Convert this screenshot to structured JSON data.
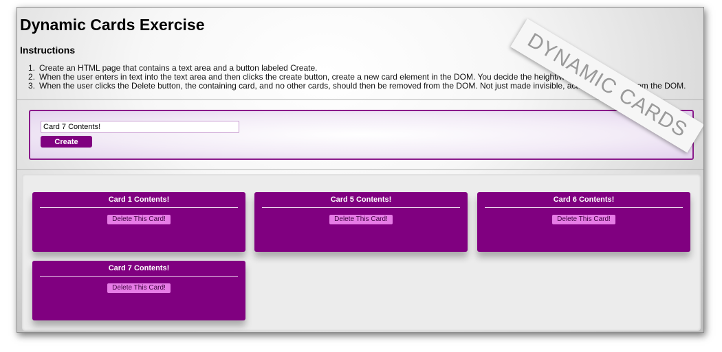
{
  "page": {
    "title": "Dynamic Cards Exercise",
    "instructions_heading": "Instructions",
    "instructions": [
      "Create an HTML page that contains a text area and a button labeled Create.",
      "When the user enters in text into the text area and then clicks the create button, create a new card element in the DOM. You decide the height/width of the card.",
      "When the user clicks the Delete button, the containing card, and no other cards, should then be removed from the DOM. Not just made invisible, actually removed from the DOM."
    ]
  },
  "form": {
    "input_value": "Card 7 Contents!",
    "create_label": "Create"
  },
  "cards": [
    {
      "title": "Card 1 Contents!",
      "delete_label": "Delete This Card!"
    },
    {
      "title": "Card 5 Contents!",
      "delete_label": "Delete This Card!"
    },
    {
      "title": "Card 6 Contents!",
      "delete_label": "Delete This Card!"
    },
    {
      "title": "Card 7 Contents!",
      "delete_label": "Delete This Card!"
    }
  ],
  "banner": {
    "text": "DYNAMIC CARDS"
  },
  "colors": {
    "accent": "#800080",
    "delete_button": "#e67ce6",
    "panel_border": "#8a1a8a"
  }
}
